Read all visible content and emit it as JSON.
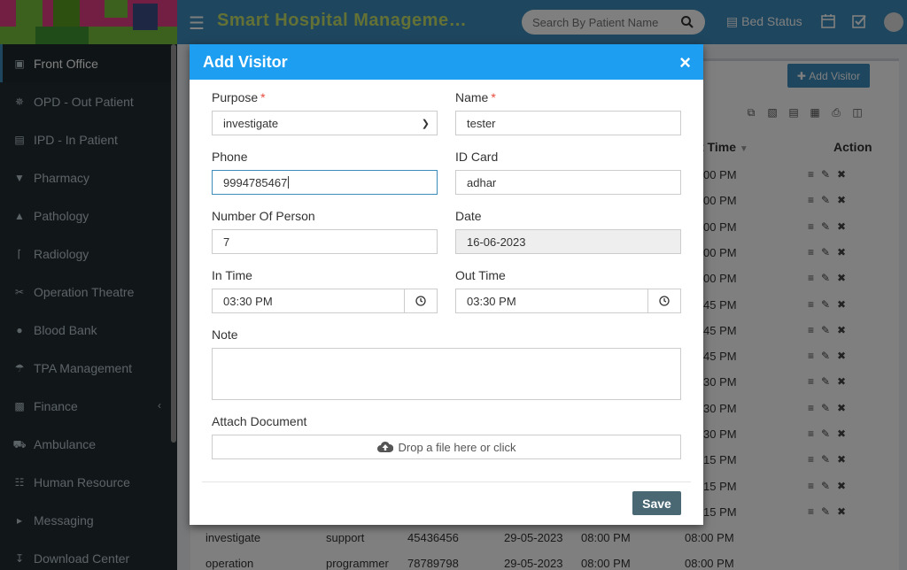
{
  "header": {
    "app_title": "Smart Hospital Manageme…",
    "search_placeholder": "Search By Patient Name",
    "bed_status": "Bed Status"
  },
  "sidebar": {
    "items": [
      {
        "label": "Front Office",
        "icon": "front-office-icon"
      },
      {
        "label": "OPD - Out Patient",
        "icon": "stethoscope-icon"
      },
      {
        "label": "IPD - In Patient",
        "icon": "bed-icon"
      },
      {
        "label": "Pharmacy",
        "icon": "mortar-icon"
      },
      {
        "label": "Pathology",
        "icon": "flask-icon"
      },
      {
        "label": "Radiology",
        "icon": "microscope-icon"
      },
      {
        "label": "Operation Theatre",
        "icon": "scissors-icon"
      },
      {
        "label": "Blood Bank",
        "icon": "drop-icon"
      },
      {
        "label": "TPA Management",
        "icon": "umbrella-icon"
      },
      {
        "label": "Finance",
        "icon": "money-icon"
      },
      {
        "label": "Ambulance",
        "icon": "ambulance-icon"
      },
      {
        "label": "Human Resource",
        "icon": "sitemap-icon"
      },
      {
        "label": "Messaging",
        "icon": "bullhorn-icon"
      },
      {
        "label": "Download Center",
        "icon": "download-icon"
      }
    ]
  },
  "background": {
    "add_visitor_label": "Add Visitor",
    "col_time": "t Time",
    "col_action": "Action",
    "times": [
      "00 PM",
      "00 PM",
      "00 PM",
      "00 PM",
      "00 PM",
      "45 PM",
      "45 PM",
      "45 PM",
      "30 PM",
      "30 PM",
      "30 PM",
      "15 PM",
      "15 PM",
      "15 PM"
    ],
    "rows": [
      {
        "purpose": "investigate",
        "name": "support",
        "phone": "45436456",
        "date": "29-05-2023",
        "in_time": "08:00 PM",
        "out_time": "08:00 PM"
      },
      {
        "purpose": "operation",
        "name": "programmer",
        "phone": "78789798",
        "date": "29-05-2023",
        "in_time": "08:00 PM",
        "out_time": "08:00 PM"
      }
    ]
  },
  "modal": {
    "title": "Add Visitor",
    "purpose": {
      "label": "Purpose",
      "value": "investigate"
    },
    "name": {
      "label": "Name",
      "value": "tester"
    },
    "phone": {
      "label": "Phone",
      "value": "9994785467"
    },
    "id_card": {
      "label": "ID Card",
      "value": "adhar"
    },
    "num_person": {
      "label": "Number Of Person",
      "value": "7"
    },
    "date": {
      "label": "Date",
      "value": "16-06-2023"
    },
    "in_time": {
      "label": "In Time",
      "value": "03:30 PM"
    },
    "out_time": {
      "label": "Out Time",
      "value": "03:30 PM"
    },
    "note": {
      "label": "Note",
      "value": ""
    },
    "attach": {
      "label": "Attach Document",
      "dropzone_text": "Drop a file here or click"
    },
    "save_label": "Save",
    "required_mark": "*"
  }
}
